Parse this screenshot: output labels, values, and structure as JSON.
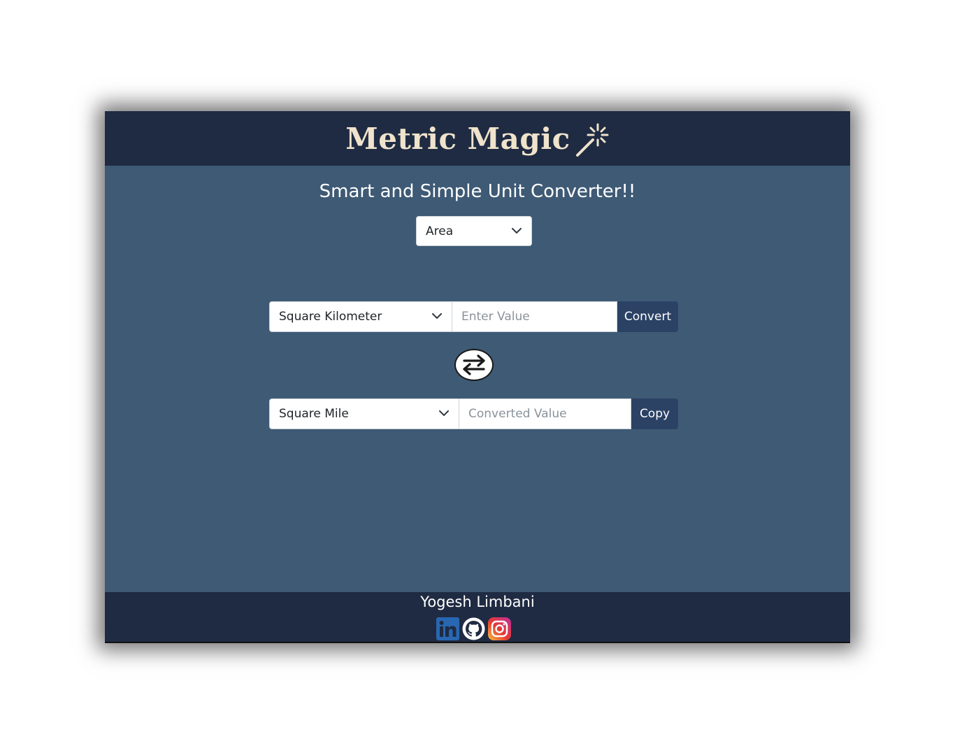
{
  "header": {
    "title": "Metric Magic",
    "icon": "magic-wand-icon"
  },
  "main": {
    "subtitle": "Smart and Simple Unit Converter!!",
    "category": {
      "selected": "Area",
      "icon": "chevron-down-icon"
    },
    "from": {
      "unit_selected": "Square Kilometer",
      "input_placeholder": "Enter Value",
      "button_label": "Convert"
    },
    "swap": {
      "icon": "swap-arrows-icon"
    },
    "to": {
      "unit_selected": "Square Mile",
      "output_placeholder": "Converted Value",
      "button_label": "Copy"
    }
  },
  "footer": {
    "author": "Yogesh Limbani",
    "social": [
      "linkedin-icon",
      "github-icon",
      "instagram-icon"
    ]
  },
  "colors": {
    "page_background": "#ffffff",
    "header_footer": "#1f2b42",
    "body": "#3e5a75",
    "title_text": "#efe3cc",
    "button": "#2b4265"
  }
}
